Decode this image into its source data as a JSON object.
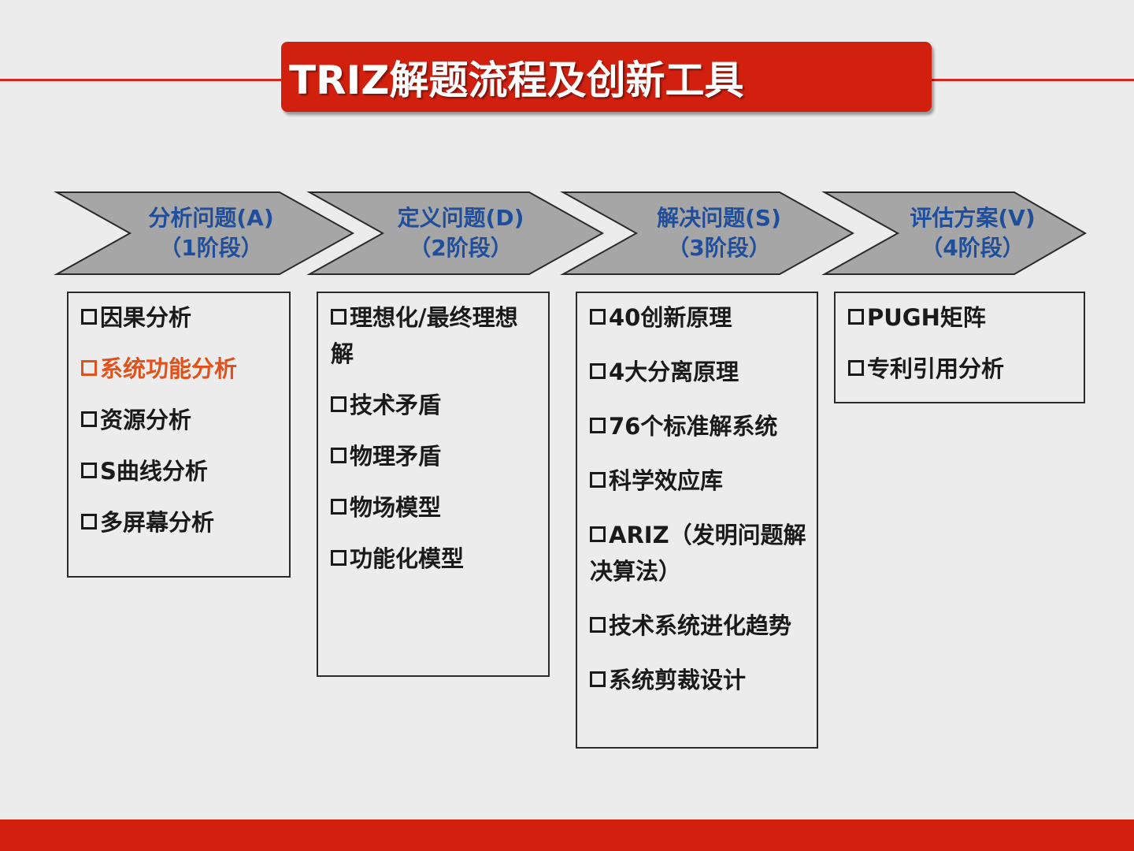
{
  "title": "TRIZ解题流程及创新工具",
  "colors": {
    "title_red": "#d2200f",
    "arrow_gray": "#a6a6a6",
    "stage_blue": "#1f4e9c",
    "highlight_orange": "#e0521c"
  },
  "stages": [
    {
      "label_line1": "分析问题(A)",
      "label_line2": "（1阶段）",
      "items": [
        "因果分析",
        "系统功能分析",
        "资源分析",
        "S曲线分析",
        "多屏幕分析"
      ],
      "highlighted_item": "系统功能分析"
    },
    {
      "label_line1": "定义问题(D)",
      "label_line2": "（2阶段）",
      "items": [
        "理想化/最终理想解",
        "技术矛盾",
        "物理矛盾",
        "物场模型",
        "功能化模型"
      ]
    },
    {
      "label_line1": "解决问题(S)",
      "label_line2": "（3阶段）",
      "items": [
        "40创新原理",
        "4大分离原理",
        "76个标准解系统",
        "科学效应库",
        "ARIZ（发明问题解决算法）",
        "技术系统进化趋势",
        "系统剪裁设计"
      ]
    },
    {
      "label_line1": "评估方案(V)",
      "label_line2": "（4阶段）",
      "items": [
        "PUGH矩阵",
        "专利引用分析"
      ]
    }
  ]
}
